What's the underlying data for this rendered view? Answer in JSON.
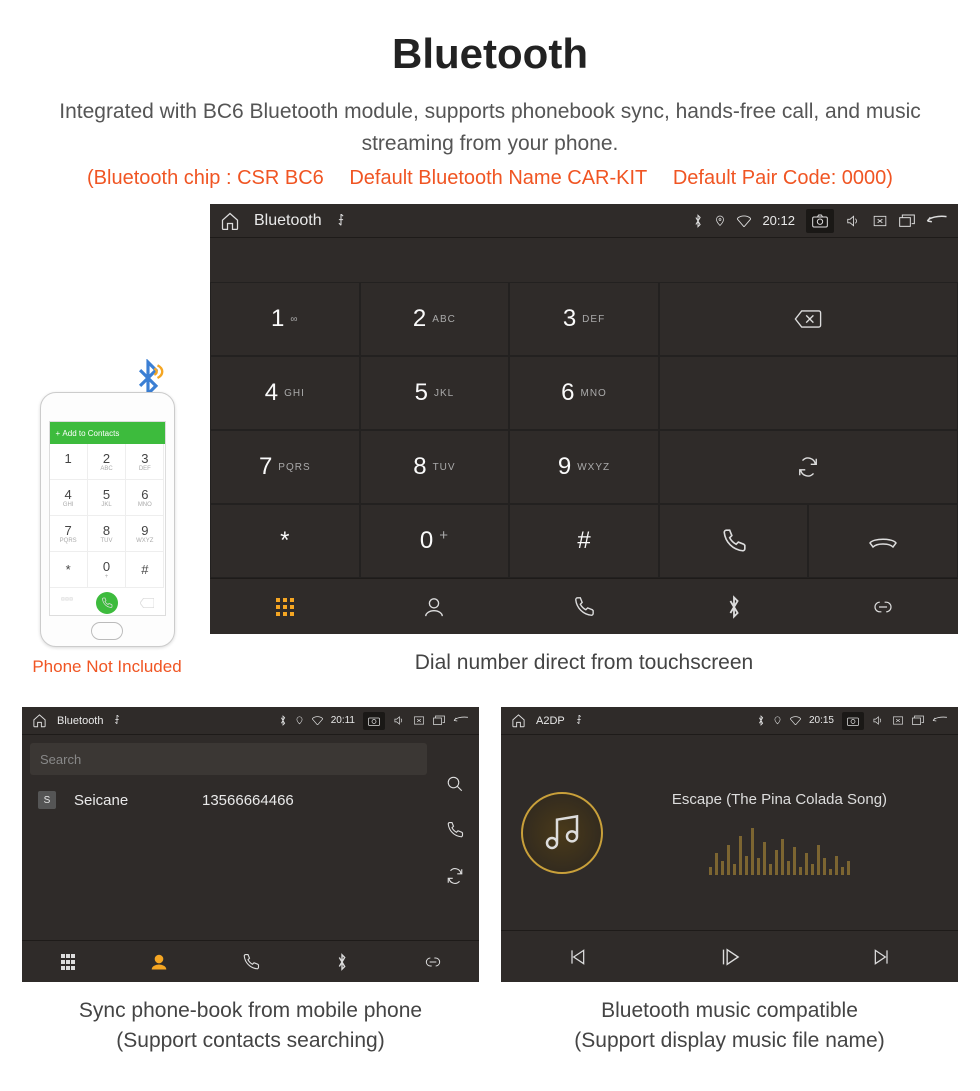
{
  "page": {
    "title": "Bluetooth",
    "subtitle": "Integrated with BC6 Bluetooth module, supports phonebook sync, hands-free call, and music streaming from your phone.",
    "specs_chip": "(Bluetooth chip : CSR BC6",
    "specs_name": "Default Bluetooth Name CAR-KIT",
    "specs_code": "Default Pair Code: 0000)"
  },
  "phone_mock": {
    "top_label": "Add to Contacts",
    "not_included": "Phone Not Included"
  },
  "dialer": {
    "status_title": "Bluetooth",
    "time": "20:12",
    "keys": [
      {
        "n": "1",
        "l": "∞"
      },
      {
        "n": "2",
        "l": "ABC"
      },
      {
        "n": "3",
        "l": "DEF"
      },
      {
        "n": "4",
        "l": "GHI"
      },
      {
        "n": "5",
        "l": "JKL"
      },
      {
        "n": "6",
        "l": "MNO"
      },
      {
        "n": "7",
        "l": "PQRS"
      },
      {
        "n": "8",
        "l": "TUV"
      },
      {
        "n": "9",
        "l": "WXYZ"
      },
      {
        "n": "*",
        "l": ""
      },
      {
        "n": "0",
        "l": "+"
      },
      {
        "n": "#",
        "l": ""
      }
    ],
    "caption": "Dial number direct from touchscreen"
  },
  "contacts": {
    "status_title": "Bluetooth",
    "time": "20:11",
    "search_placeholder": "Search",
    "name": "Seicane",
    "number": "13566664466",
    "caption_line1": "Sync phone-book from mobile phone",
    "caption_line2": "(Support contacts searching)"
  },
  "music": {
    "status_title": "A2DP",
    "time": "20:15",
    "track": "Escape (The Pina Colada Song)",
    "caption_line1": "Bluetooth music compatible",
    "caption_line2": "(Support display music file name)"
  }
}
